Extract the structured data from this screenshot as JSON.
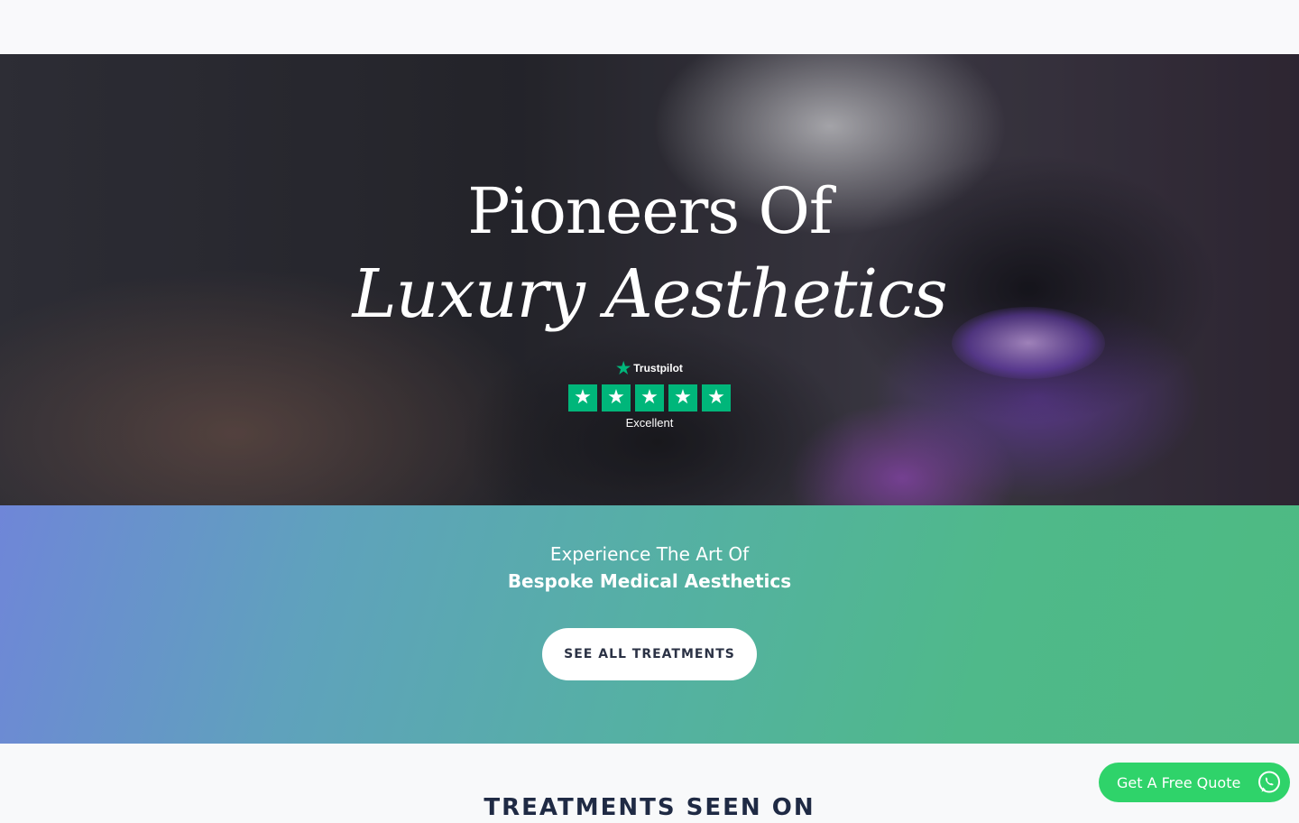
{
  "hero": {
    "title_line_1": "Pioneers Of",
    "title_line_2": "Luxury Aesthetics",
    "trustpilot": {
      "brand": "Trustpilot",
      "stars": 5,
      "rating_text": "Excellent",
      "star_color": "#00b67a"
    }
  },
  "band": {
    "line_1": "Experience The Art Of",
    "line_2": "Bespoke Medical Aesthetics",
    "cta_label": "SEE ALL TREATMENTS"
  },
  "treatments_section": {
    "title": "TREATMENTS SEEN ON"
  },
  "floating_quote": {
    "label": "Get A Free Quote",
    "icon": "whatsapp-icon",
    "color": "#2fd36a"
  }
}
